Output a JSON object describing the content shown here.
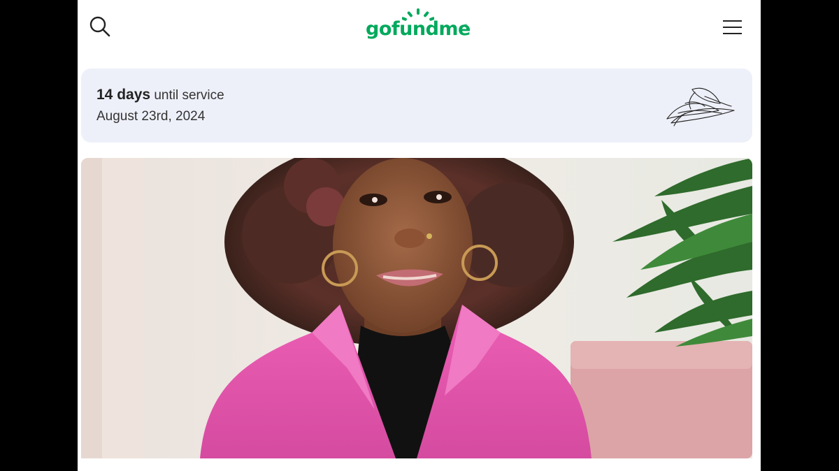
{
  "header": {
    "search_icon": "search-icon",
    "logo_text": "gofundme",
    "logo_tm": "®",
    "menu_icon": "hamburger-menu-icon",
    "brand_color": "#02a95c"
  },
  "service": {
    "days": "14 days",
    "until_text": "until service",
    "date": "August 23rd, 2024",
    "illustration_icon": "leaf-illustration-icon",
    "card_color": "#eef0f9"
  },
  "hero": {
    "image_icon": "campaign-photo"
  }
}
